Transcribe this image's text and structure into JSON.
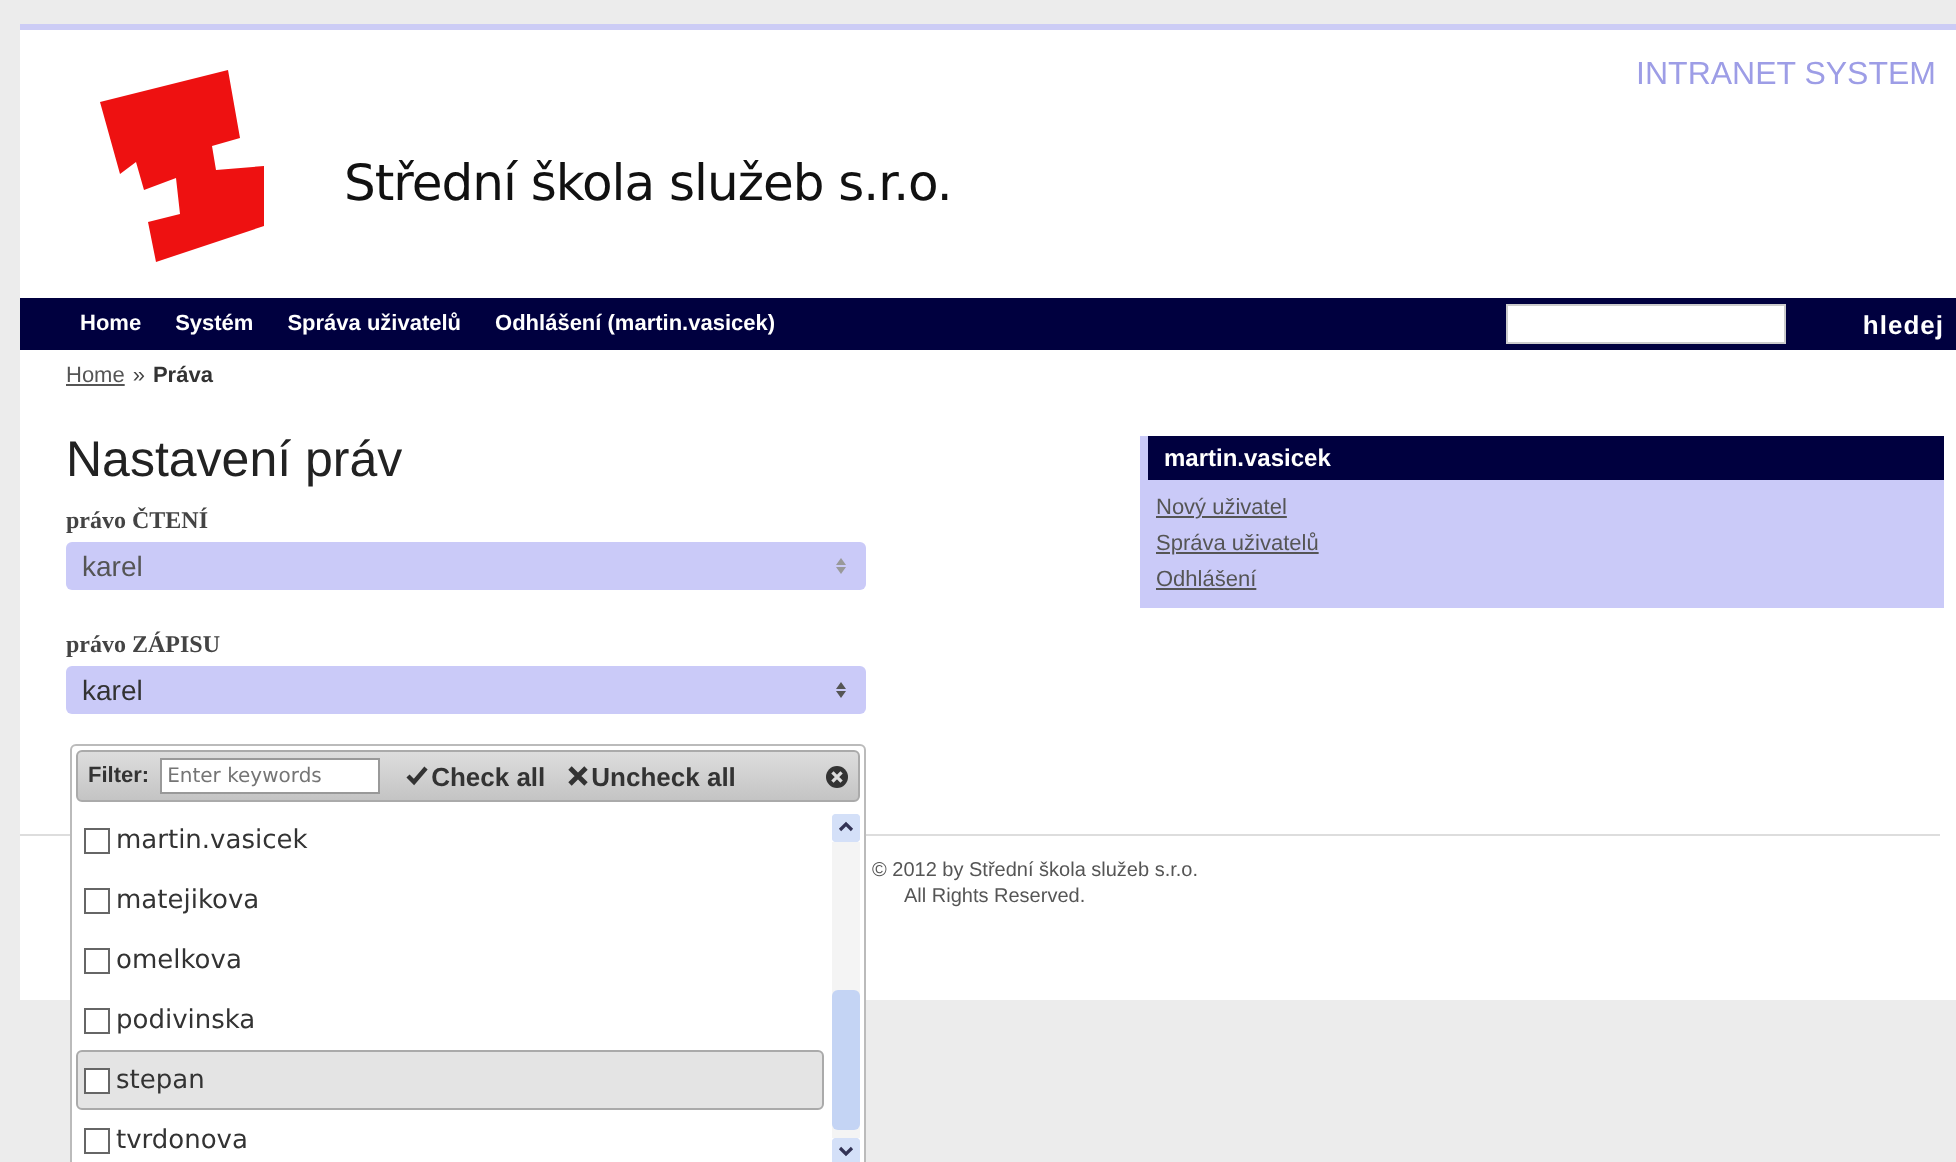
{
  "header": {
    "site_title": "Střední škola služeb s.r.o.",
    "system_label": "INTRANET SYSTEM"
  },
  "nav": {
    "items": [
      "Home",
      "Systém",
      "Správa uživatelů",
      "Odhlášení (martin.vasicek)"
    ],
    "search_button": "hledej"
  },
  "breadcrumb": {
    "link": "Home",
    "separator": "»",
    "current": "Práva"
  },
  "form": {
    "heading": "Nastavení práv",
    "fields": [
      {
        "label": "právo ČTENÍ",
        "value": "karel",
        "focused": false
      },
      {
        "label": "právo ZÁPISU",
        "value": "karel",
        "focused": true
      }
    ],
    "dropdown": {
      "filter_label": "Filter:",
      "filter_placeholder": "Enter keywords",
      "check_all": "Check all",
      "uncheck_all": "Uncheck all",
      "options": [
        {
          "label": "martin.vasicek",
          "checked": false,
          "highlighted": false
        },
        {
          "label": "matejikova",
          "checked": false,
          "highlighted": false
        },
        {
          "label": "omelkova",
          "checked": false,
          "highlighted": false
        },
        {
          "label": "podivinska",
          "checked": false,
          "highlighted": false
        },
        {
          "label": "stepan",
          "checked": false,
          "highlighted": true
        },
        {
          "label": "tvrdonova",
          "checked": false,
          "highlighted": false
        }
      ]
    }
  },
  "user_box": {
    "title": "martin.vasicek",
    "links": [
      "Nový uživatel",
      "Správa uživatelů",
      "Odhlášení"
    ]
  },
  "footer": {
    "copyright": "© 2012 by Střední škola služeb s.r.o.",
    "rights": "All Rights Reserved."
  }
}
